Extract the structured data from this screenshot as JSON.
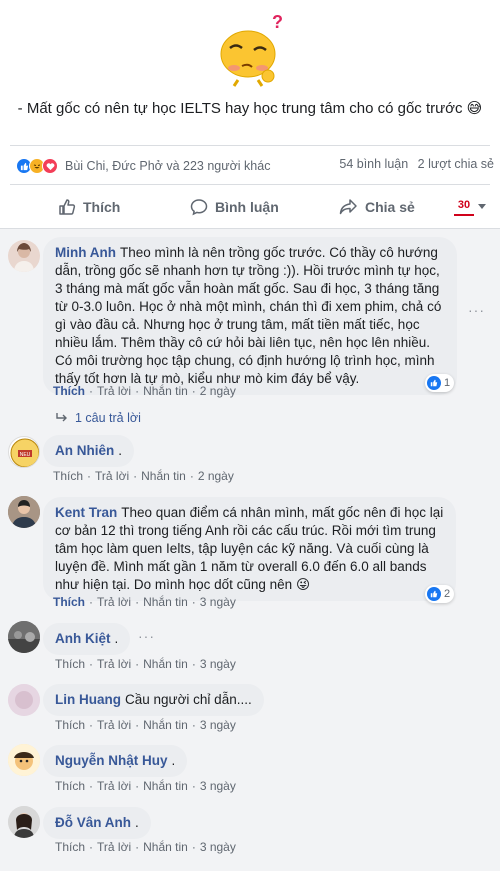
{
  "post": {
    "caption": "- Mất gốc có nên tự học IELTS hay học trung tâm cho có gốc trước 😅"
  },
  "reactions": {
    "names": "Bùi Chi, Đức Phở và 223 người khác",
    "comments_count": "54 bình luận",
    "shares_count": "2 lượt chia sẻ"
  },
  "actions": {
    "like": "Thích",
    "comment": "Bình luận",
    "share": "Chia sẻ",
    "page_logo": "30"
  },
  "comments": [
    {
      "name": "Minh Anh",
      "text": "Theo mình là nên trồng gốc trước. Có thầy cô hướng dẫn, trồng gốc sẽ nhanh hơn tự trồng :)). Hồi trước mình tự học, 3 tháng mà mất gốc vẫn hoàn mất gốc. Sau đi học, 3 tháng tăng từ 0-3.0 luôn. Học ở nhà một mình, chán thì đi xem phim, chả có gì vào đầu cả. Nhưng học ở trung tâm, mất tiền mất tiếc, học nhiều lắm. Thêm thầy cô cứ hỏi bài liên tục, nên học lên nhiều. Có môi trường học tập chung, có định hướng lộ trình học, mình thấy tốt hơn là tự mò, kiểu như mò kim đáy bể vậy.",
      "like_label": "Thích",
      "reply_label": "Trả lời",
      "message_label": "Nhắn tin",
      "time": "2 ngày",
      "like_count": "1",
      "replies_label": "1 câu trả lời"
    },
    {
      "name": "An Nhiên",
      "text": ".",
      "like_label": "Thích",
      "reply_label": "Trả lời",
      "message_label": "Nhắn tin",
      "time": "2 ngày"
    },
    {
      "name": "Kent Tran",
      "text": "Theo quan điểm cá nhân mình, mất gốc nên đi học lại cơ bản 12 thì trong tiếng Anh rồi các cấu trúc. Rồi mới tìm trung tâm học làm quen Ielts, tập luyện các kỹ năng. Và cuối cùng là luyện đề. Mình mất gần 1 năm từ overall 6.0 đến 6.0 all bands như hiện tại. Do mình học dốt cũng nên 😜",
      "like_label": "Thích",
      "reply_label": "Trả lời",
      "message_label": "Nhắn tin",
      "time": "3 ngày",
      "like_count": "2"
    },
    {
      "name": "Anh Kiệt",
      "text": ".",
      "like_label": "Thích",
      "reply_label": "Trả lời",
      "message_label": "Nhắn tin",
      "time": "3 ngày"
    },
    {
      "name": "Lin Huang",
      "text": "Cầu người chỉ dẫn....",
      "like_label": "Thích",
      "reply_label": "Trả lời",
      "message_label": "Nhắn tin",
      "time": "3 ngày"
    },
    {
      "name": "Nguyễn Nhật Huy",
      "text": ".",
      "like_label": "Thích",
      "reply_label": "Trả lời",
      "message_label": "Nhắn tin",
      "time": "3 ngày"
    },
    {
      "name": "Đỗ Vân Anh",
      "text": ".",
      "like_label": "Thích",
      "reply_label": "Trả lời",
      "message_label": "Nhắn tin",
      "time": "3 ngày"
    }
  ],
  "colors": {
    "link_blue": "#385898",
    "like_blue": "#1877f2",
    "bubble_gray": "#ebedf0",
    "brand_red": "#d0021b"
  },
  "icons": [
    "confused-emoji-icon",
    "like-reaction-icon",
    "haha-reaction-icon",
    "love-reaction-icon",
    "thumbs-up-icon",
    "comment-icon",
    "share-icon",
    "caret-down-icon",
    "reply-arrow-icon",
    "more-dots-icon"
  ]
}
